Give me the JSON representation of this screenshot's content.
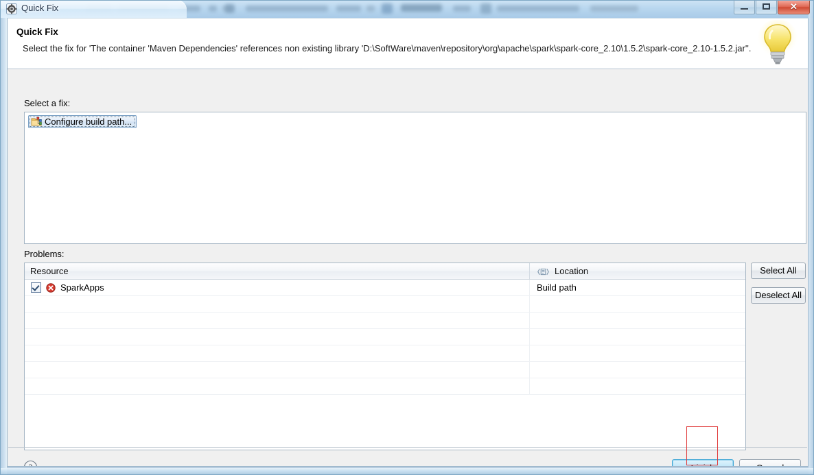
{
  "window": {
    "title": "Quick Fix",
    "app_icon": "quickfix-icon",
    "controls": {
      "minimize": "–",
      "maximize": "□",
      "close": "✕"
    }
  },
  "header": {
    "title": "Quick Fix",
    "message": "Select the fix for 'The container 'Maven Dependencies' references non existing library 'D:\\SoftWare\\maven\\repository\\org\\apache\\spark\\spark-core_2.10\\1.5.2\\spark-core_2.10-1.5.2.jar''.",
    "bulb_icon": "lightbulb-icon"
  },
  "fix_section": {
    "label": "Select a fix:",
    "items": [
      {
        "label": "Configure build path...",
        "icon": "build-path-icon",
        "selected": true
      }
    ]
  },
  "problems_section": {
    "label": "Problems:",
    "columns": [
      {
        "key": "resource",
        "label": "Resource",
        "icon": ""
      },
      {
        "key": "location",
        "label": "Location",
        "icon": "location-column-icon"
      }
    ],
    "rows": [
      {
        "checked": true,
        "severity": "error",
        "resource": "SparkApps",
        "location": "Build path"
      }
    ],
    "empty_row_count": 6,
    "buttons": {
      "select_all": "Select All",
      "deselect_all": "Deselect All"
    }
  },
  "footer": {
    "help_icon": "help-icon",
    "finish": "Finish",
    "cancel": "Cancel"
  },
  "colors": {
    "accent": "#3fa7d6",
    "error": "#d93b30",
    "annotation": "#e03a3a",
    "header_bg": "#ffffff",
    "body_bg": "#f0f0f0"
  }
}
